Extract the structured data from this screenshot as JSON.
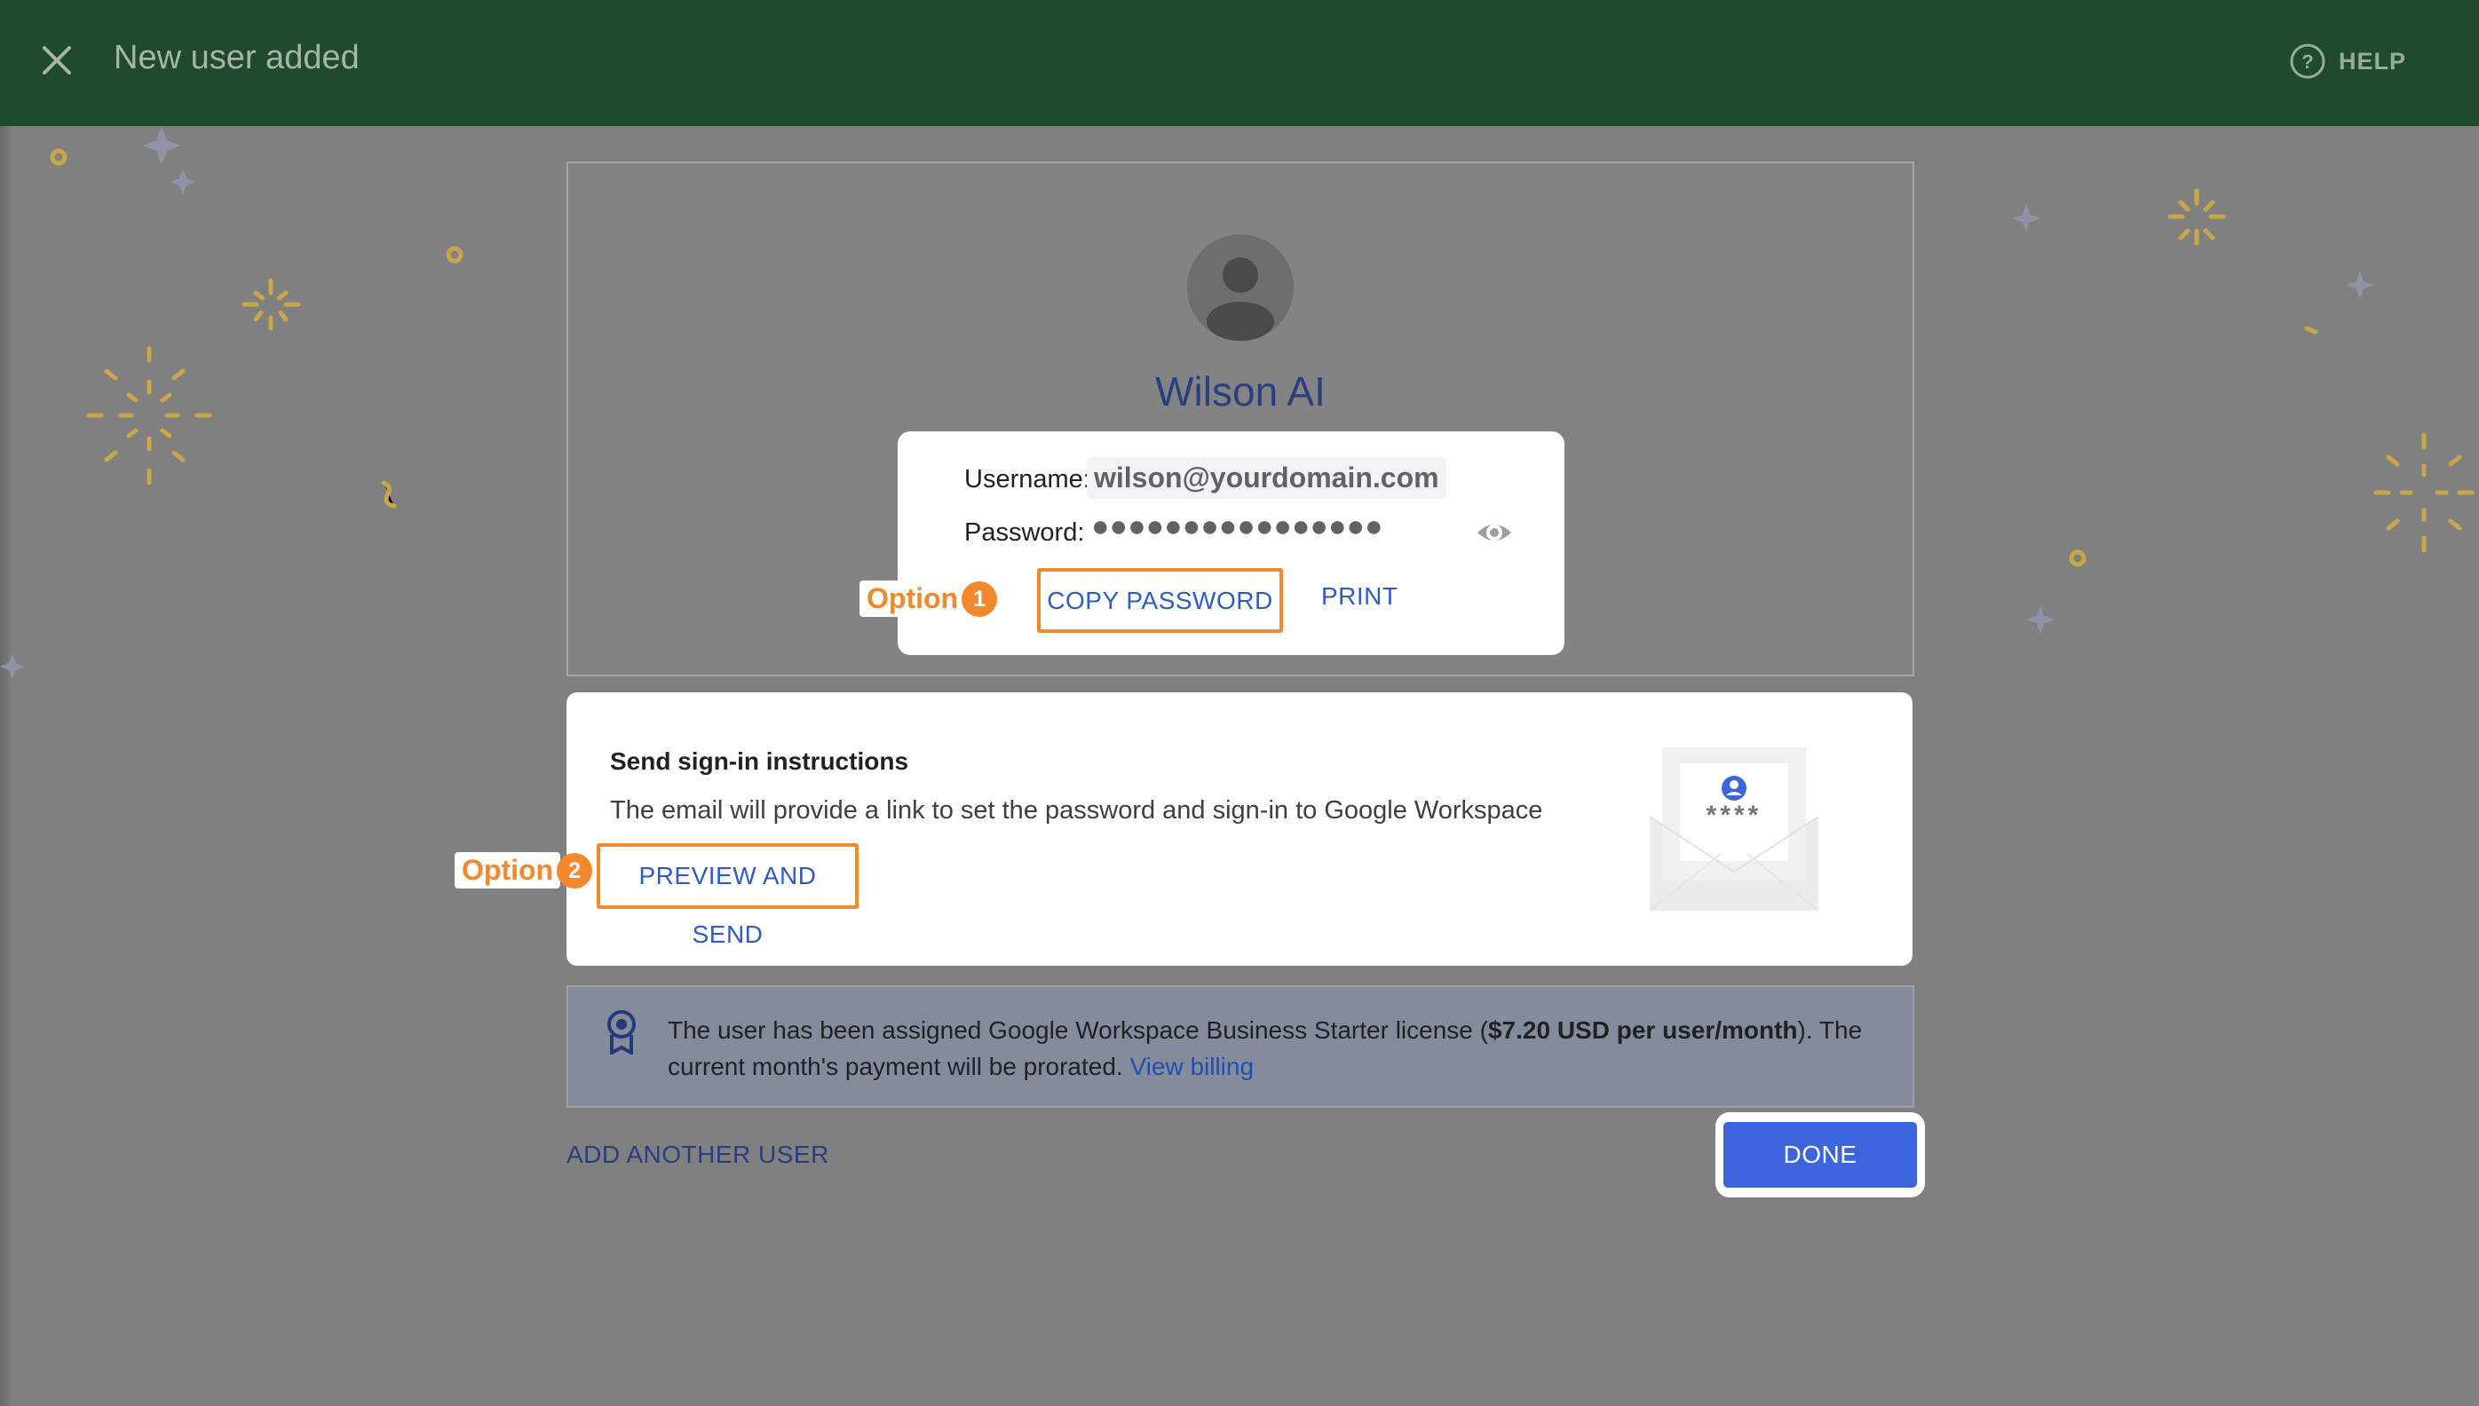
{
  "header": {
    "title": "New user added",
    "help_label": "HELP",
    "close_icon": "close-icon",
    "help_icon": "help-circle-icon"
  },
  "user": {
    "name": "Wilson AI",
    "username_label": "Username:",
    "username": "wilson@yourdomain.com",
    "password_label": "Password:",
    "password_masked": "●●●●●●●●●●●●●●●●",
    "copy_password_label": "COPY PASSWORD",
    "print_label": "PRINT"
  },
  "callouts": {
    "option_text": "Option",
    "option1_number": "1",
    "option2_number": "2"
  },
  "send": {
    "title": "Send sign-in instructions",
    "description": "The email will provide a link to set the password and sign-in to Google Workspace",
    "preview_label": "PREVIEW AND SEND",
    "envelope_mask": "****"
  },
  "license": {
    "text_before": "The user has been assigned Google Workspace Business Starter license (",
    "price": "$7.20 USD per user/month",
    "text_after": "). The current month's payment will be prorated. ",
    "billing_link": "View billing"
  },
  "actions": {
    "add_another_label": "ADD ANOTHER USER",
    "done_label": "DONE"
  },
  "colors": {
    "header_bg": "#1f4a2c",
    "accent_blue": "#3c64dc",
    "callout_orange": "#f4892c",
    "link_blue": "#2f5bc4"
  }
}
